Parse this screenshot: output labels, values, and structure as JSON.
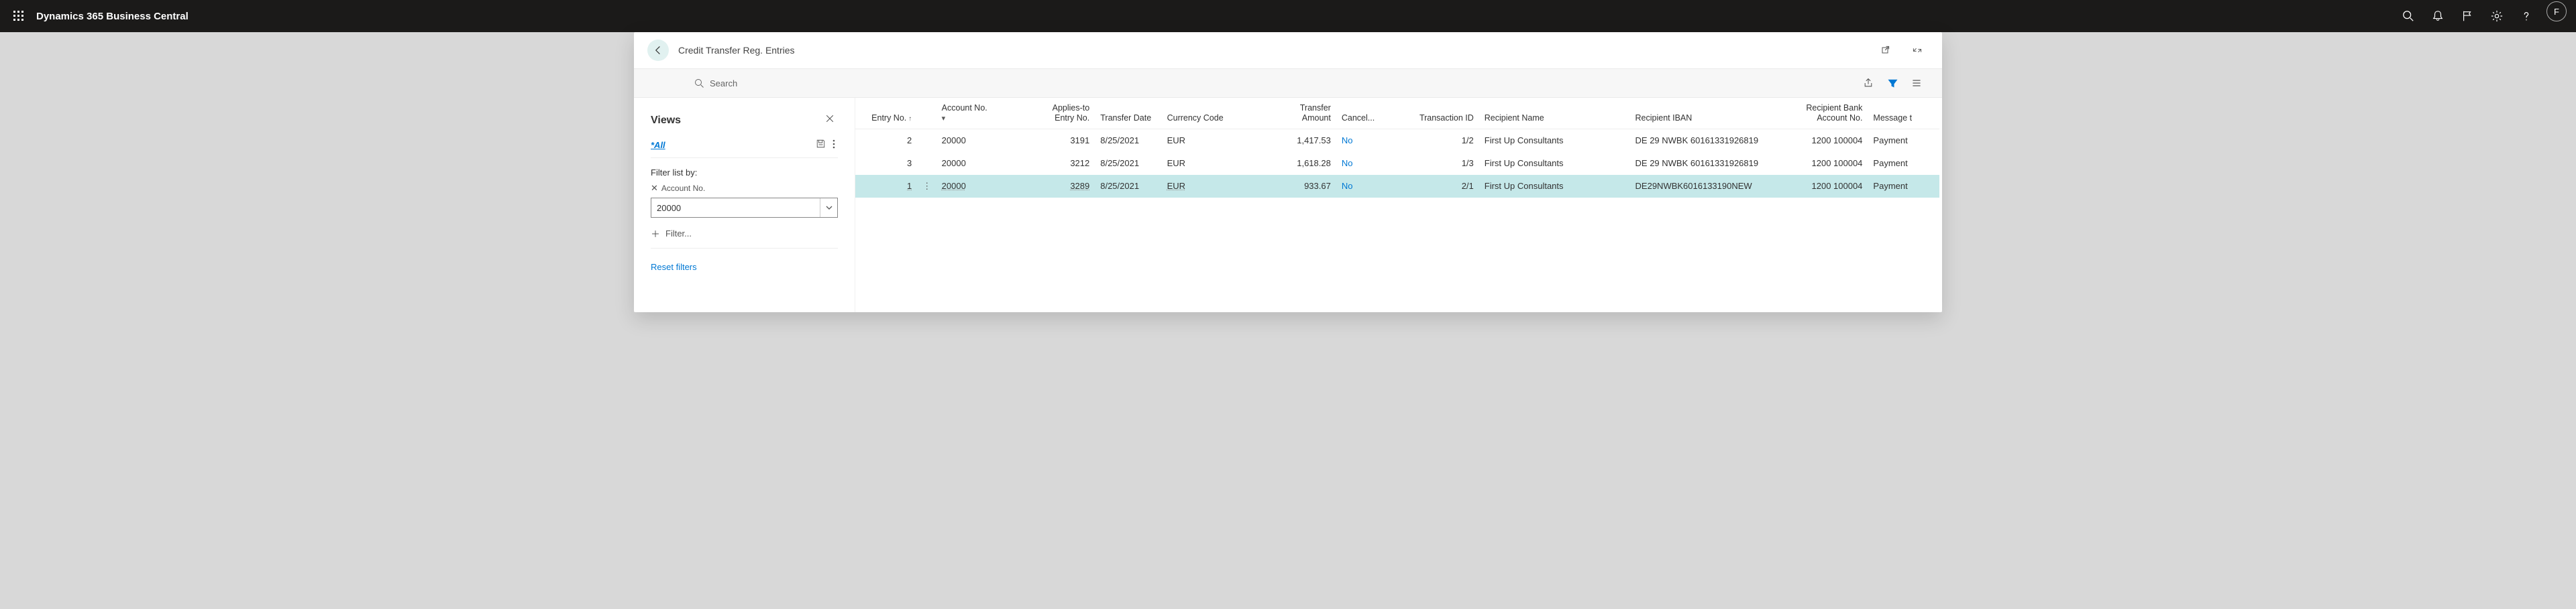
{
  "app": {
    "title": "Dynamics 365 Business Central",
    "avatar_initial": "F"
  },
  "page": {
    "title": "Credit Transfer Reg. Entries",
    "search_label": "Search"
  },
  "filter_pane": {
    "views_label": "Views",
    "all_label": "*All",
    "filter_by_label": "Filter list by:",
    "account_no_label": "Account No.",
    "filter_value": "20000",
    "add_filter_label": "Filter...",
    "reset_label": "Reset filters"
  },
  "columns": {
    "entry_no": "Entry No.",
    "account_no": "Account No.",
    "applies_to": "Applies-to Entry No.",
    "transfer_date": "Transfer Date",
    "currency": "Currency Code",
    "transfer_amount": "Transfer Amount",
    "canceled": "Cancel...",
    "transaction_id": "Transaction ID",
    "recipient_name": "Recipient Name",
    "recipient_iban": "Recipient IBAN",
    "recipient_bank": "Recipient Bank Account No.",
    "message": "Message t"
  },
  "rows": [
    {
      "entry_no": "2",
      "account_no": "20000",
      "applies_to": "3191",
      "transfer_date": "8/25/2021",
      "currency": "EUR",
      "transfer_amount": "1,417.53",
      "canceled": "No",
      "transaction_id": "1/2",
      "recipient_name": "First Up Consultants",
      "recipient_iban": "DE 29 NWBK 60161331926819",
      "recipient_bank": "1200 100004",
      "message": "Payment"
    },
    {
      "entry_no": "3",
      "account_no": "20000",
      "applies_to": "3212",
      "transfer_date": "8/25/2021",
      "currency": "EUR",
      "transfer_amount": "1,618.28",
      "canceled": "No",
      "transaction_id": "1/3",
      "recipient_name": "First Up Consultants",
      "recipient_iban": "DE 29 NWBK 60161331926819",
      "recipient_bank": "1200 100004",
      "message": "Payment"
    },
    {
      "entry_no": "1",
      "account_no": "20000",
      "applies_to": "3289",
      "transfer_date": "8/25/2021",
      "currency": "EUR",
      "transfer_amount": "933.67",
      "canceled": "No",
      "transaction_id": "2/1",
      "recipient_name": "First Up Consultants",
      "recipient_iban": "DE29NWBK6016133190NEW",
      "recipient_bank": "1200 100004",
      "message": "Payment"
    }
  ]
}
